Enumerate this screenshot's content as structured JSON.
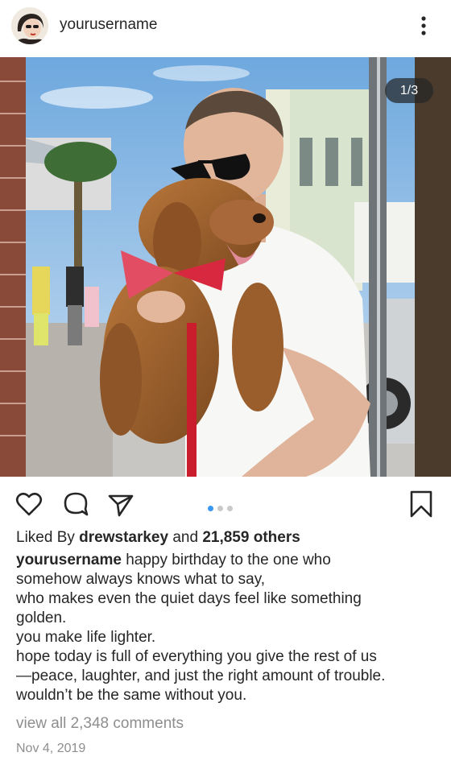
{
  "post": {
    "username": "yourusername",
    "media_counter": "1/3",
    "carousel": {
      "count": 3,
      "active_index": 1
    }
  },
  "likes": {
    "prefix": "Liked By",
    "user": "drewstarkey",
    "joiner": "and",
    "others": "21,859 others"
  },
  "caption": {
    "username": "yourusername",
    "lines": [
      "happy birthday to the one who",
      "somehow always knows what to say,",
      "who makes even the quiet days feel like something",
      "golden.",
      "you make life lighter.",
      "hope today is full of everything you give the rest of us",
      "—peace, laughter, and just the right amount of trouble.",
      "wouldn’t be the same without you."
    ]
  },
  "comments_link": "view all 2,348 comments",
  "date": "Nov 4, 2019",
  "icons": {
    "more": "more-vertical-icon",
    "like": "heart-icon",
    "comment": "comment-bubble-icon",
    "share": "paper-plane-icon",
    "save": "bookmark-icon"
  },
  "colors": {
    "text": "#262626",
    "muted": "#8e8e8e",
    "accent": "#3897f0"
  }
}
